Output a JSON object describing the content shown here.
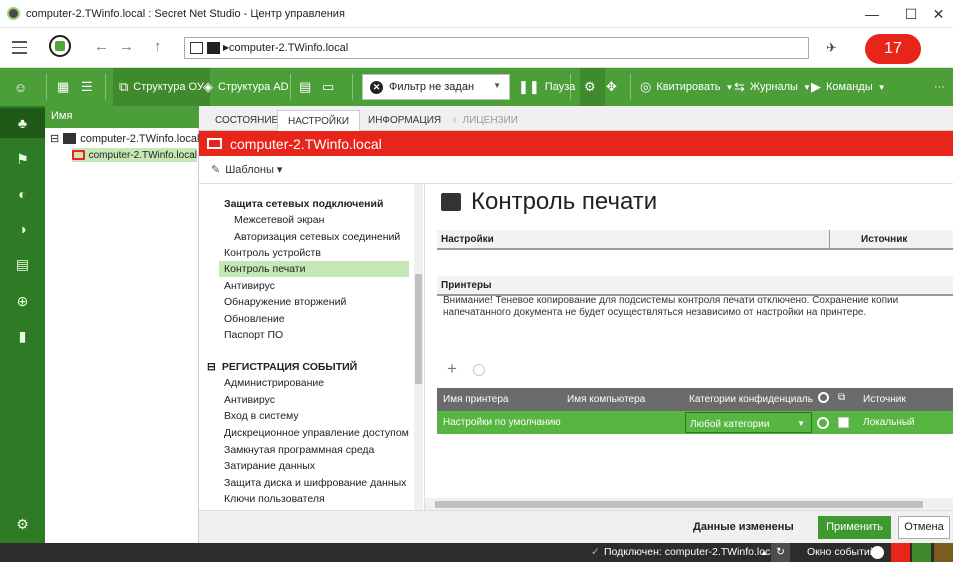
{
  "window": {
    "title": "computer-2.TWinfo.local : Secret Net Studio - Центр управления",
    "minimize": "—",
    "maximize": "☐",
    "close": "✕"
  },
  "address": {
    "path": "computer-2.TWinfo.local",
    "badge": "17"
  },
  "toolbar": {
    "structure_ou": "Структура ОУ",
    "structure_ad": "Структура AD",
    "filter": "Фильтр не задан",
    "pause": "Пауза",
    "acknowledge": "Квитировать",
    "journals": "Журналы",
    "commands": "Команды",
    "more": "···"
  },
  "tree": {
    "header": "Имя",
    "items": [
      {
        "label": "computer-2.TWinfo.local",
        "expander": "⊟"
      },
      {
        "label": "computer-2.TWinfo.local"
      }
    ]
  },
  "tabs": [
    {
      "label": "СОСТОЯНИЕ"
    },
    {
      "label": "НАСТРОЙКИ"
    },
    {
      "label": "ИНФОРМАЦИЯ"
    },
    {
      "label": "ЛИЦЕНЗИИ"
    }
  ],
  "computer_title": "computer-2.TWinfo.local",
  "templates_label": "Шаблоны ▾",
  "settings_tree": {
    "items": [
      {
        "label": "Защита сетевых подключений"
      },
      {
        "label": "Межсетевой экран"
      },
      {
        "label": "Авторизация сетевых соединений"
      },
      {
        "label": "Контроль устройств"
      },
      {
        "label": "Контроль печати"
      },
      {
        "label": "Антивирус"
      },
      {
        "label": "Обнаружение вторжений"
      },
      {
        "label": "Обновление"
      },
      {
        "label": "Паспорт ПО"
      }
    ],
    "events_section": {
      "expander": "⊟",
      "label": "РЕГИСТРАЦИЯ СОБЫТИЙ"
    },
    "event_items": [
      {
        "label": "Администрирование"
      },
      {
        "label": "Антивирус"
      },
      {
        "label": "Вход в систему"
      },
      {
        "label": "Дискреционное управление доступом"
      },
      {
        "label": "Замкнутая программная среда"
      },
      {
        "label": "Затирание данных"
      },
      {
        "label": "Защита диска и шифрование данных"
      },
      {
        "label": "Ключи пользователя"
      }
    ]
  },
  "content": {
    "title": "Контроль печати",
    "settings_group": {
      "label": "Настройки",
      "source": "Источник"
    },
    "printers_group": {
      "label": "Принтеры"
    },
    "warning": "Внимание! Теневое копирование для подсистемы контроля печати отключено. Сохранение копии напечатанного документа не будет осуществляться независимо от настройки на принтере.",
    "table": {
      "columns": [
        "Имя принтера",
        "Имя компьютера",
        "Категории конфиденциаль",
        "Источник"
      ],
      "rows": [
        {
          "printer": "Настройки по умолчанию",
          "computer": "",
          "category": "Любой категории",
          "source": "Локальный"
        }
      ]
    }
  },
  "footer": {
    "status": "Данные изменены",
    "apply": "Применить",
    "cancel": "Отмена"
  },
  "statusbar": {
    "connected": "Подключен: computer-2.TWinfo.local",
    "events_window": "Окно событий"
  }
}
